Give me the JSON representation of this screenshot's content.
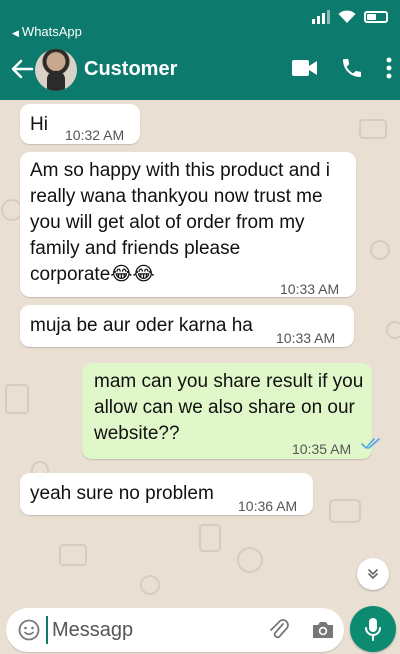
{
  "status_bar": {
    "back_app_label": "WhatsApp"
  },
  "header": {
    "contact_name": "Customer",
    "icons": [
      "back-arrow-icon",
      "video-call-icon",
      "voice-call-icon",
      "more-options-icon"
    ]
  },
  "messages": [
    {
      "direction": "incoming",
      "text": "Hi",
      "time": "10:32 AM"
    },
    {
      "direction": "incoming",
      "lines": [
        "Am so happy with this product and i",
        "really wana thankyou now trust me",
        "you will get alot of order from my",
        "family and friends please",
        "corporate😂😂"
      ],
      "time": "10:33 AM"
    },
    {
      "direction": "incoming",
      "text": "muja be aur oder karna ha",
      "time": "10:33 AM"
    },
    {
      "direction": "outgoing",
      "lines": [
        "mam can you share result if you",
        "allow can we also share on our",
        "website??"
      ],
      "time": "10:35 AM",
      "status": "read"
    },
    {
      "direction": "incoming",
      "text": "yeah sure no problem",
      "time": "10:36 AM"
    }
  ],
  "composer": {
    "value": "Messagp",
    "placeholder": "Message"
  },
  "colors": {
    "header": "#0c7a6c",
    "outgoing_bubble": "#e0f8c9",
    "incoming_bubble": "#ffffff",
    "wallpaper": "#e9dfd2",
    "read_ticks": "#4fa8e0",
    "mic_button": "#0c8a72"
  }
}
